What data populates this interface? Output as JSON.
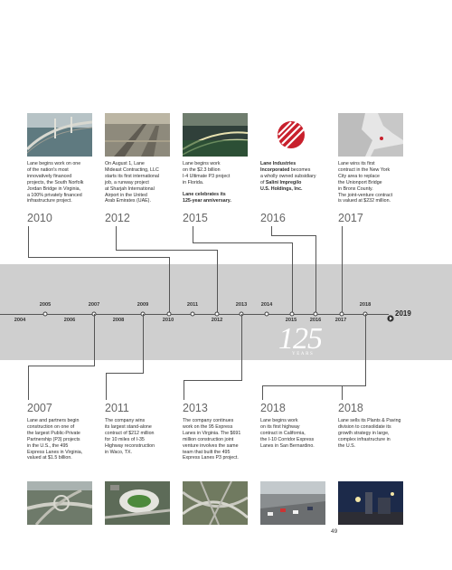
{
  "top_events": [
    {
      "year": "2010",
      "text": "Lane begins work on one\nof the nation's most\ninnovatively financed\nprojects, the South Norfolk\nJordan Bridge in Virginia,\na 100% privately financed\ninfrastructure project.",
      "photo": "bridge-aerial"
    },
    {
      "year": "2012",
      "text": "On August 1, Lane\nMideast Contracting, LLC\nstarts its first international\njob, a runway project\nat Sharjah International\nAirport in the United\nArab Emirates (UAE).",
      "photo": "runway-aerial"
    },
    {
      "year": "2015",
      "text": "Lane begins work\non the $2.3 billion\nI-4 Ultimate P3 project\nin Florida.",
      "text2": "Lane celebrates its\n125-year anniversary.",
      "photo": "highway-night"
    },
    {
      "year": "2016",
      "text_bold": "Lane Industries\nIncorporated",
      "text": " becomes\na wholly owned subsidiary\nof ",
      "text_bold2": "Salini Impregilo\nU.S. Holdings, Inc.",
      "photo": "salini-logo"
    },
    {
      "year": "2017",
      "text": "Lane wins its first\ncontract in the New York\nCity area to replace\nthe Unionport Bridge\nin Bronx County.\nThe joint-venture contract\nis valued at $232 million.",
      "photo": "ny-map"
    }
  ],
  "bottom_events": [
    {
      "year": "2007",
      "text": "Lane and partners begin\nconstruction on one of\nthe largest Public-Private\nPartnership (P3) projects\nin the U.S., the 495\nExpress Lanes in Virginia,\nvalued at $1.5 billion.",
      "photo": "interchange-aerial"
    },
    {
      "year": "2011",
      "text": "The company wins\nits largest stand-alone\ncontract of $212 million\nfor 10 miles of I-35\nHighway reconstruction\nin Waco, TX.",
      "photo": "stadium-aerial"
    },
    {
      "year": "2013",
      "text": "The company continues\nwork on the 95 Express\nLanes in Virginia. The $691\nmillion construction joint\nventure involves the same\nteam that built the 495\nExpress Lanes P3 project.",
      "photo": "freeway-interchange"
    },
    {
      "year": "2018",
      "text": "Lane begins work\non its first highway\ncontract in California,\nthe I-10 Corridor Express\nLanes in San Bernardino.",
      "photo": "traffic-freeway"
    },
    {
      "year": "2018",
      "text": "Lane sells its Plants & Paving\ndivision to consolidate its\ngrowth strategy in large,\ncomplex infrastructure in\nthe U.S.",
      "photo": "plant-night"
    }
  ],
  "timeline": {
    "upper_ticks": [
      "2005",
      "2007",
      "2009",
      "2011",
      "2013",
      "2014",
      "2018"
    ],
    "lower_ticks": [
      "2004",
      "2006",
      "2008",
      "2010",
      "2012",
      "2015",
      "2016",
      "2017"
    ],
    "end_year": "2019"
  },
  "anniversary": {
    "number": "125",
    "label": "YEARS"
  },
  "page_number": "49"
}
